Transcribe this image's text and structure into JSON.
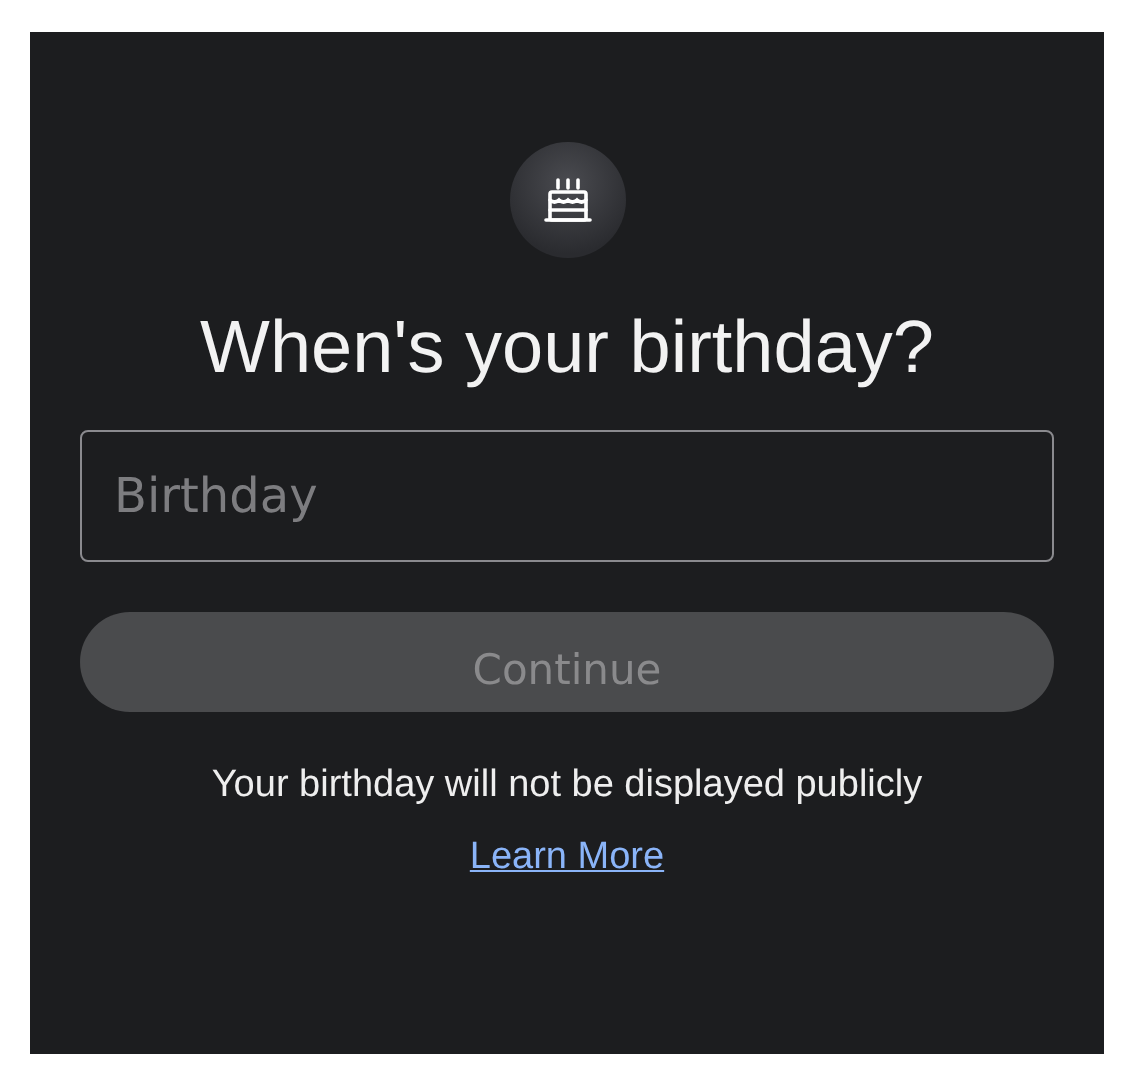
{
  "heading": "When's your birthday?",
  "birthday_field": {
    "placeholder": "Birthday"
  },
  "continue_button": {
    "label": "Continue",
    "disabled": true
  },
  "disclaimer": "Your birthday will not be displayed publicly",
  "learn_more_link": "Learn More"
}
